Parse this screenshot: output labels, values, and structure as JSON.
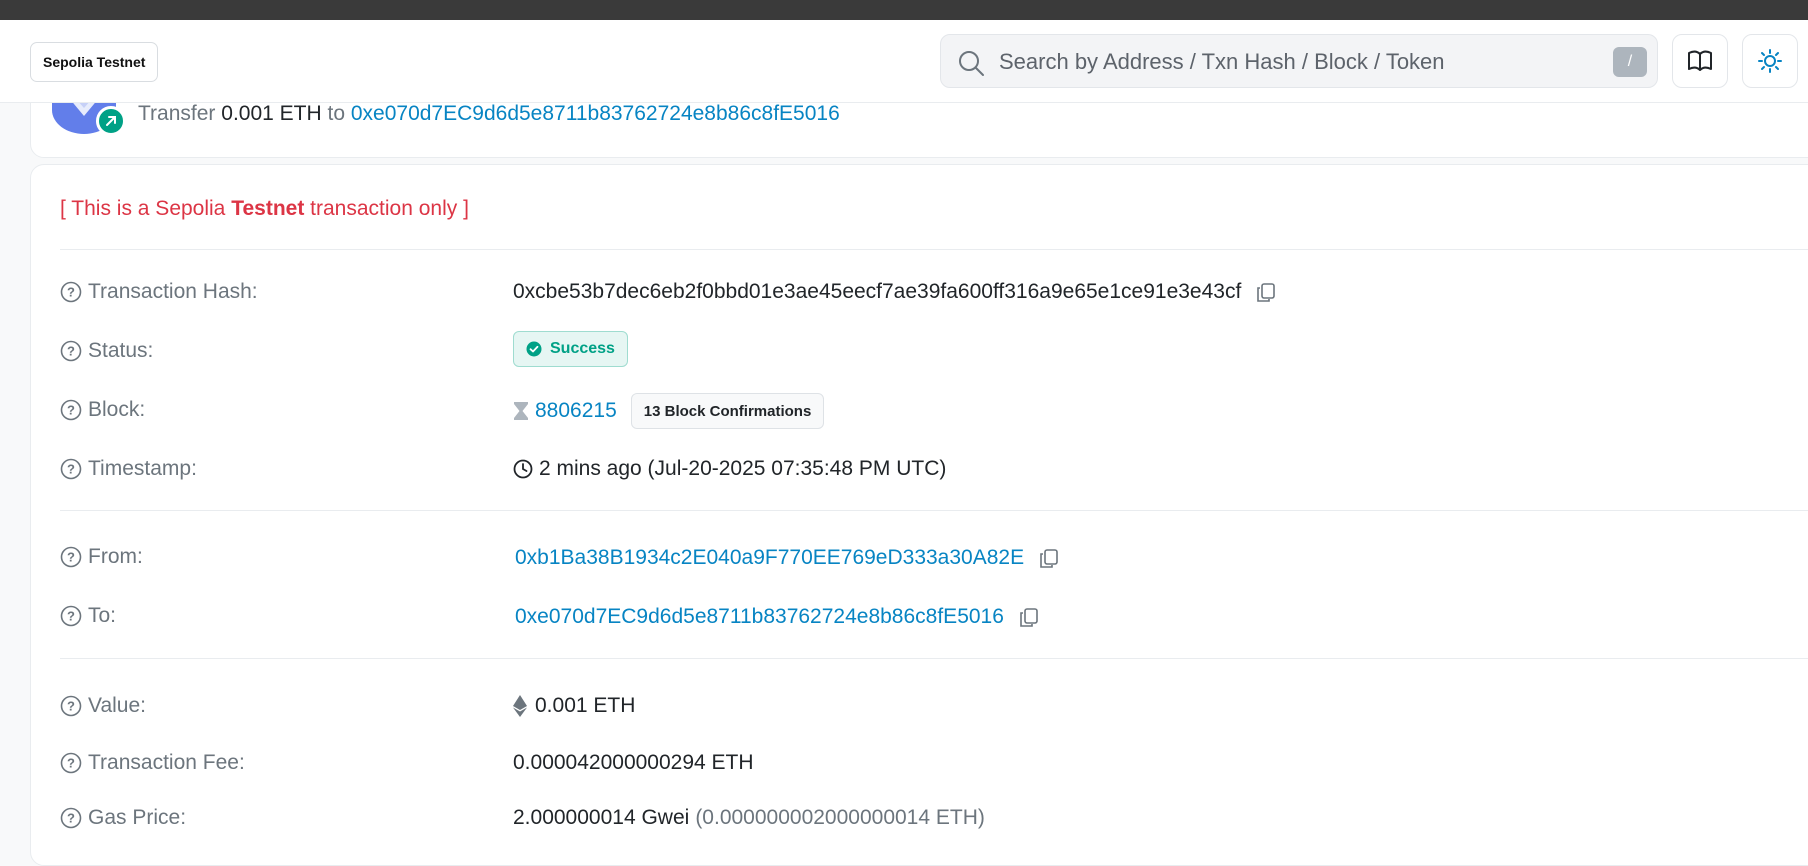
{
  "header": {
    "network_badge": "Sepolia Testnet",
    "search_placeholder": "Search by Address / Txn Hash / Block / Token",
    "search_shortcut": "/"
  },
  "summary": {
    "prefix": "Transfer",
    "amount": "0.001 ETH",
    "to_word": "to",
    "to_address": "0xe070d7EC9d6d5e8711b83762724e8b86c8fE5016"
  },
  "testnet_note": {
    "open": "[ This is a Sepolia ",
    "bold": "Testnet",
    "close": " transaction only ]"
  },
  "details": {
    "tx_hash_label": "Transaction Hash:",
    "tx_hash": "0xcbe53b7dec6eb2f0bbd01e3ae45eecf7ae39fa600ff316a9e65e1ce91e3e43cf",
    "status_label": "Status:",
    "status": "Success",
    "block_label": "Block:",
    "block": "8806215",
    "confirmations": "13 Block Confirmations",
    "timestamp_label": "Timestamp:",
    "timestamp": "2 mins ago (Jul-20-2025 07:35:48 PM UTC)",
    "from_label": "From:",
    "from": "0xb1Ba38B1934c2E040a9F770EE769eD333a30A82E",
    "to_label": "To:",
    "to": "0xe070d7EC9d6d5e8711b83762724e8b86c8fE5016",
    "value_label": "Value:",
    "value": "0.001 ETH",
    "fee_label": "Transaction Fee:",
    "fee": "0.000042000000294 ETH",
    "gas_label": "Gas Price:",
    "gas_gwei": "2.000000014 Gwei",
    "gas_eth": "(0.000000002000000014 ETH)"
  },
  "colors": {
    "link": "#0784c3",
    "success": "#00a186",
    "testnet_red": "#dc3545"
  }
}
